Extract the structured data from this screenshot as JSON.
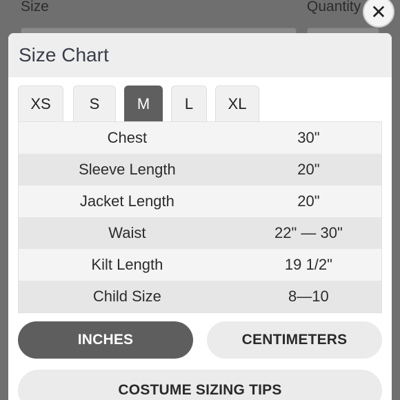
{
  "background": {
    "size_label": "Size",
    "quantity_label": "Quantity"
  },
  "close_button": {
    "icon": "close-icon",
    "glyph": "✕"
  },
  "modal": {
    "title": "Size Chart",
    "tabs": [
      {
        "label": "XS",
        "active": false
      },
      {
        "label": "S",
        "active": false
      },
      {
        "label": "M",
        "active": true
      },
      {
        "label": "L",
        "active": false
      },
      {
        "label": "XL",
        "active": false
      }
    ],
    "rows": [
      {
        "label": "Chest",
        "value": "30\""
      },
      {
        "label": "Sleeve Length",
        "value": "20\""
      },
      {
        "label": "Jacket Length",
        "value": "20\""
      },
      {
        "label": "Waist",
        "value": "22\" — 30\""
      },
      {
        "label": "Kilt Length",
        "value": "19 1/2\""
      },
      {
        "label": "Child Size",
        "value": "8—10"
      }
    ],
    "unit_buttons": {
      "inches": "INCHES",
      "centimeters": "CENTIMETERS",
      "selected": "inches"
    },
    "tips_button": "COSTUME SIZING TIPS"
  },
  "colors": {
    "active_tab": "#5f5f5f",
    "row_odd": "#f4f4f4",
    "row_even": "#e6e6e6",
    "overlay": "#6f6f6f"
  }
}
